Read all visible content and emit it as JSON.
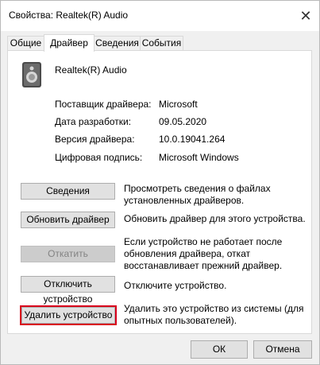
{
  "window": {
    "title": "Свойства: Realtek(R) Audio"
  },
  "tabs": [
    {
      "label": "Общие"
    },
    {
      "label": "Драйвер"
    },
    {
      "label": "Сведения"
    },
    {
      "label": "События"
    }
  ],
  "active_tab": "Драйвер",
  "device": {
    "name": "Realtek(R) Audio",
    "icon": "speaker-icon"
  },
  "info": [
    {
      "label": "Поставщик драйвера:",
      "value": "Microsoft"
    },
    {
      "label": "Дата разработки:",
      "value": "09.05.2020"
    },
    {
      "label": "Версия драйвера:",
      "value": "10.0.19041.264"
    },
    {
      "label": "Цифровая подпись:",
      "value": "Microsoft Windows"
    }
  ],
  "actions": [
    {
      "button": "Сведения",
      "description": "Просмотреть сведения о файлах установленных драйверов."
    },
    {
      "button": "Обновить драйвер",
      "description": "Обновить драйвер для этого устройства."
    },
    {
      "button": "Откатить",
      "description": "Если устройство не работает после обновления драйвера, откат восстанавливает прежний драйвер."
    },
    {
      "button": "Отключить устройство",
      "description": "Отключите устройство."
    },
    {
      "button": "Удалить устройство",
      "description": "Удалить это устройство из системы (для опытных пользователей)."
    }
  ],
  "footer": {
    "ok": "ОК",
    "cancel": "Отмена"
  },
  "colors": {
    "highlight": "#d9001b"
  }
}
